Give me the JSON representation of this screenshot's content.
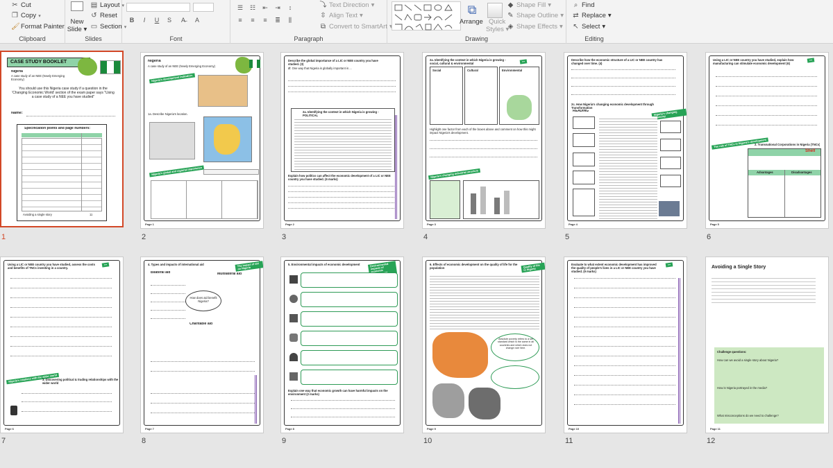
{
  "ribbon": {
    "clipboard": {
      "cut": "Cut",
      "copy": "Copy",
      "format_painter": "Format Painter",
      "label": "Clipboard"
    },
    "slides": {
      "new_slide": "New",
      "new_slide2": "Slide",
      "layout": "Layout",
      "reset": "Reset",
      "section": "Section",
      "label": "Slides"
    },
    "font": {
      "bold": "B",
      "italic": "I",
      "underline": "U",
      "strike": "S",
      "label": "Font"
    },
    "paragraph": {
      "text_direction": "Text Direction",
      "align_text": "Align Text",
      "convert": "Convert to SmartArt",
      "label": "Paragraph"
    },
    "drawing": {
      "arrange": "Arrange",
      "quick_styles": "Quick",
      "quick_styles2": "Styles",
      "shape_fill": "Shape Fill",
      "shape_outline": "Shape Outline",
      "shape_effects": "Shape Effects",
      "label": "Drawing"
    },
    "editing": {
      "find": "Find",
      "replace": "Replace",
      "select": "Select",
      "label": "Editing"
    }
  },
  "slides": [
    {
      "n": "1",
      "title": "CASE STUDY BOOKLET",
      "sub": "Nigeria",
      "sub2": "A case study of an NEE (Newly Emerging Economy)",
      "body": "You should use this Nigeria case study if a question in the 'Changing Economic World' section of the exam paper says \"Using a case study of a NEE you have studied\"",
      "name": "Name:",
      "spec": "Specification points and page numbers:",
      "end": "Avoiding a single story",
      "end_n": "11"
    },
    {
      "n": "2",
      "title": "Nigeria",
      "sub": "A case study of an NEE (Newly Emerging Economy)",
      "tag": "Nigeria's development indicators",
      "q": "1a. Describe Nigeria's location.",
      "tag2": "Nigeria's global and regional importance",
      "foot": "Page 1"
    },
    {
      "n": "3",
      "q": "Describe the global importance of a LIC or NEE country you have studied. (3)",
      "ans": "Ø: One way that Nigeria is globally important is ...",
      "heading": "2a. Identifying the context in which Nigeria is growing - POLITICAL",
      "q2": "Explain how politics can affect the economic development of a LIC or NEE country you have studied. (6 marks)",
      "foot": "Page 2"
    },
    {
      "n": "4",
      "heading": "2a. Identifying the context in which Nigeria is growing - social, cultural & environmental",
      "c1": "Social",
      "c2": "Cultural",
      "c3": "Environmental",
      "tag": "Nigeria's changing industrial structure",
      "q": "Highlight one factor from each of the boxes above and comment on how this might impact Nigeria's development.",
      "foot": "Page 3"
    },
    {
      "n": "5",
      "q": "Describe how the economic structure of a LIC or NEE country has changed over time. (4)",
      "heading": "2c. How Nigeria's changing economic development through Transformation",
      "reading": "READING",
      "tag": "Nigeria's changing economy",
      "foot": "Page 4"
    },
    {
      "n": "6",
      "q": "Using a LIC or NEE country you have studied, explain how manufacturing can stimulate economic development (6)",
      "tag": "The role of TNCs in Nigeria's development",
      "heading": "2. Transnational Corporations in Nigeria (TNCs)",
      "shell": "Shell",
      "adv": "Advantages",
      "dis": "Disadvantages",
      "foot": "Page 5"
    },
    {
      "n": "7",
      "q": "Using a LIC or NEE country you have studied, assess the costs and benefits of TNCs investing in a country.",
      "tag": "Nigeria's relations with the wider world",
      "heading": "3. Discovering political & trading relationships with the wider world",
      "foot": "Page 6"
    },
    {
      "n": "8",
      "heading": "4. Types and impacts of international aid",
      "aid1": "Bilateral aid",
      "aid2": "Multilateral aid",
      "cloud": "How does aid benefit Nigeria?",
      "aid3": "Charitable aid",
      "tag": "The impact of aid on Nigeria",
      "foot": "Page 7"
    },
    {
      "n": "9",
      "heading": "5. Environmental impacts of economic development",
      "tag": "Environmental impacts of economic development",
      "q": "Explain one way that economic growth can have harmful impacts on the environment (2 marks)",
      "foot": "Page 8"
    },
    {
      "n": "10",
      "heading": "6. Effects of economic development on the quality of life for the population",
      "tag": "Quality of life in Nigeria",
      "poverty": "Absolute poverty refers to a set standard which is the same in all countries and which does not change over time.",
      "foot": "Page 9"
    },
    {
      "n": "11",
      "q": "Evaluate to what extent economic development has improved the quality of people's lives in a LIC or NEE country you have studied. (9 marks)",
      "foot": "Page 10"
    },
    {
      "n": "12",
      "title": "Avoiding a Single Story",
      "c1": "Challenge questions:",
      "c2": "How can we avoid a single story about Nigeria?",
      "c3": "How is Nigeria portrayed in the media?",
      "c4": "What misconceptions do we need to challenge?",
      "foot": "Page 11"
    }
  ],
  "colors": {
    "selection": "#d24726",
    "green": "#27a356",
    "purple": "#7c4daa"
  }
}
